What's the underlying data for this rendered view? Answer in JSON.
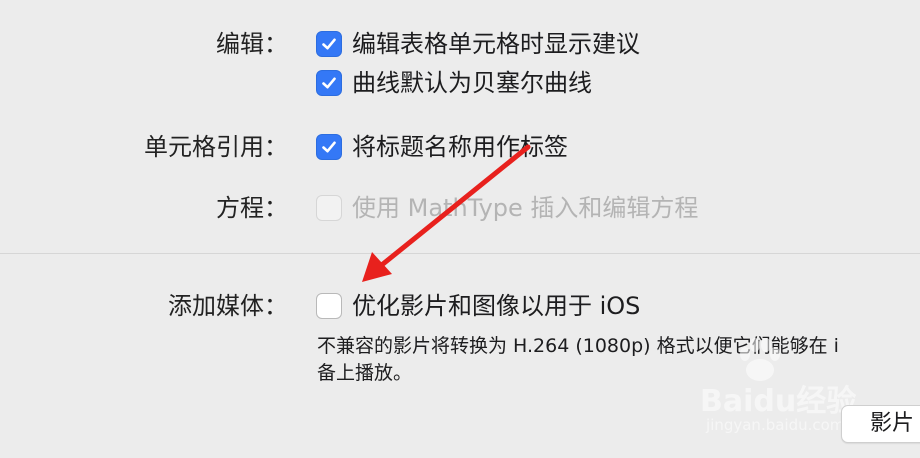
{
  "settings": {
    "edit": {
      "label": "编辑：",
      "options": [
        {
          "text": "编辑表格单元格时显示建议",
          "checked": true,
          "enabled": true
        },
        {
          "text": "曲线默认为贝塞尔曲线",
          "checked": true,
          "enabled": true
        }
      ]
    },
    "cell_reference": {
      "label": "单元格引用：",
      "options": [
        {
          "text": "将标题名称用作标签",
          "checked": true,
          "enabled": true
        }
      ]
    },
    "equation": {
      "label": "方程：",
      "options": [
        {
          "text": "使用 MathType 插入和编辑方程",
          "checked": false,
          "enabled": false
        }
      ]
    },
    "add_media": {
      "label": "添加媒体：",
      "options": [
        {
          "text": "优化影片和图像以用于 iOS",
          "checked": false,
          "enabled": true
        }
      ],
      "description_line1": "不兼容的影片将转换为 H.264 (1080p) 格式以便它们能够在 i",
      "description_line2": "备上播放。"
    }
  },
  "bottom_button": {
    "label": "影片"
  },
  "watermark": {
    "brand": "Baidu经验",
    "url": "jingyan.baidu.com"
  },
  "colors": {
    "accent": "#3478f6",
    "annotation_arrow": "#e8211d",
    "background": "#ececec"
  }
}
